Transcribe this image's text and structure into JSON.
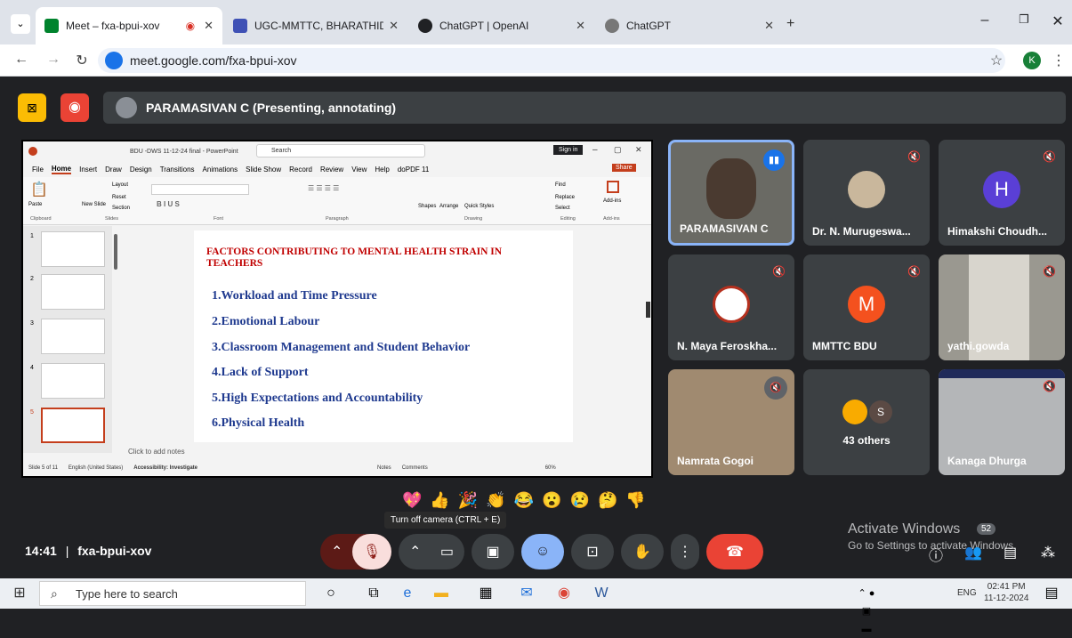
{
  "browser": {
    "tabs": [
      {
        "title": "Meet – fxa-bpui-xov",
        "active": true
      },
      {
        "title": "UGC-MMTTC, BHARATHIDASAN",
        "active": false
      },
      {
        "title": "ChatGPT | OpenAI",
        "active": false
      },
      {
        "title": "ChatGPT",
        "active": false
      }
    ],
    "url": "meet.google.com/fxa-bpui-xov",
    "profile_initial": "K"
  },
  "meet": {
    "presenter_banner": "PARAMASIVAN C (Presenting, annotating)",
    "meeting_code": "fxa-bpui-xov",
    "time": "14:41",
    "separator": "|",
    "tooltip": "Turn off camera (CTRL + E)",
    "participants": [
      {
        "name": "PARAMASIVAN C",
        "type": "video"
      },
      {
        "name": "Dr. N. Murugeswa...",
        "type": "photo"
      },
      {
        "name": "Himakshi Choudh...",
        "type": "letter",
        "initial": "H",
        "color": "#5a3fd6"
      },
      {
        "name": "N. Maya Feroskha...",
        "type": "logo"
      },
      {
        "name": "MMTTC BDU",
        "type": "letter",
        "initial": "M",
        "color": "#f4511e"
      },
      {
        "name": "yathi.gowda",
        "type": "video"
      },
      {
        "name": "Namrata Gogoi",
        "type": "video"
      },
      {
        "name": "43 others",
        "type": "group",
        "initial": "S"
      },
      {
        "name": "Kanaga Dhurga",
        "type": "video"
      }
    ],
    "reactions": [
      "💖",
      "👍",
      "🎉",
      "👏",
      "😂",
      "😮",
      "😢",
      "🤔",
      "👎"
    ],
    "activate_windows": {
      "title": "Activate Windows",
      "subtitle": "Go to Settings to activate Windows.",
      "badge": "52"
    }
  },
  "powerpoint": {
    "file_title": "BDU -DWS 11-12-24 final - PowerPoint",
    "search_placeholder": "Search",
    "sign_in": "Sign in",
    "share": "Share",
    "menu": [
      "File",
      "Home",
      "Insert",
      "Draw",
      "Design",
      "Transitions",
      "Animations",
      "Slide Show",
      "Record",
      "Review",
      "View",
      "Help",
      "doPDF 11"
    ],
    "ribbon_groups": [
      "Clipboard",
      "Slides",
      "Font",
      "Paragraph",
      "Drawing",
      "Editing",
      "Add-ins"
    ],
    "ribbon_labels": {
      "paste": "Paste",
      "new_slide": "New Slide",
      "layout": "Layout",
      "reset": "Reset",
      "section": "Section",
      "shapes": "Shapes",
      "arrange": "Arrange",
      "quick_styles": "Quick Styles",
      "find": "Find",
      "replace": "Replace",
      "select": "Select",
      "addins": "Add-ins"
    },
    "slide_title": "FACTORS CONTRIBUTING TO MENTAL HEALTH STRAIN IN TEACHERS",
    "slide_items": [
      "1.Workload and Time Pressure",
      "2.Emotional Labour",
      "3.Classroom Management and Student Behavior",
      "4.Lack of Support",
      "5.High Expectations and Accountability",
      "6.Physical Health"
    ],
    "thumb_numbers": [
      "1",
      "2",
      "3",
      "4",
      "5"
    ],
    "notes_placeholder": "Click to add notes",
    "status": {
      "slide": "Slide 5 of 11",
      "language": "English (United States)",
      "accessibility": "Accessibility: Investigate",
      "notes": "Notes",
      "comments": "Comments",
      "zoom": "60%"
    }
  },
  "taskbar": {
    "search_placeholder": "Type here to search",
    "lang": "ENG",
    "time": "02:41 PM",
    "date": "11-12-2024"
  }
}
